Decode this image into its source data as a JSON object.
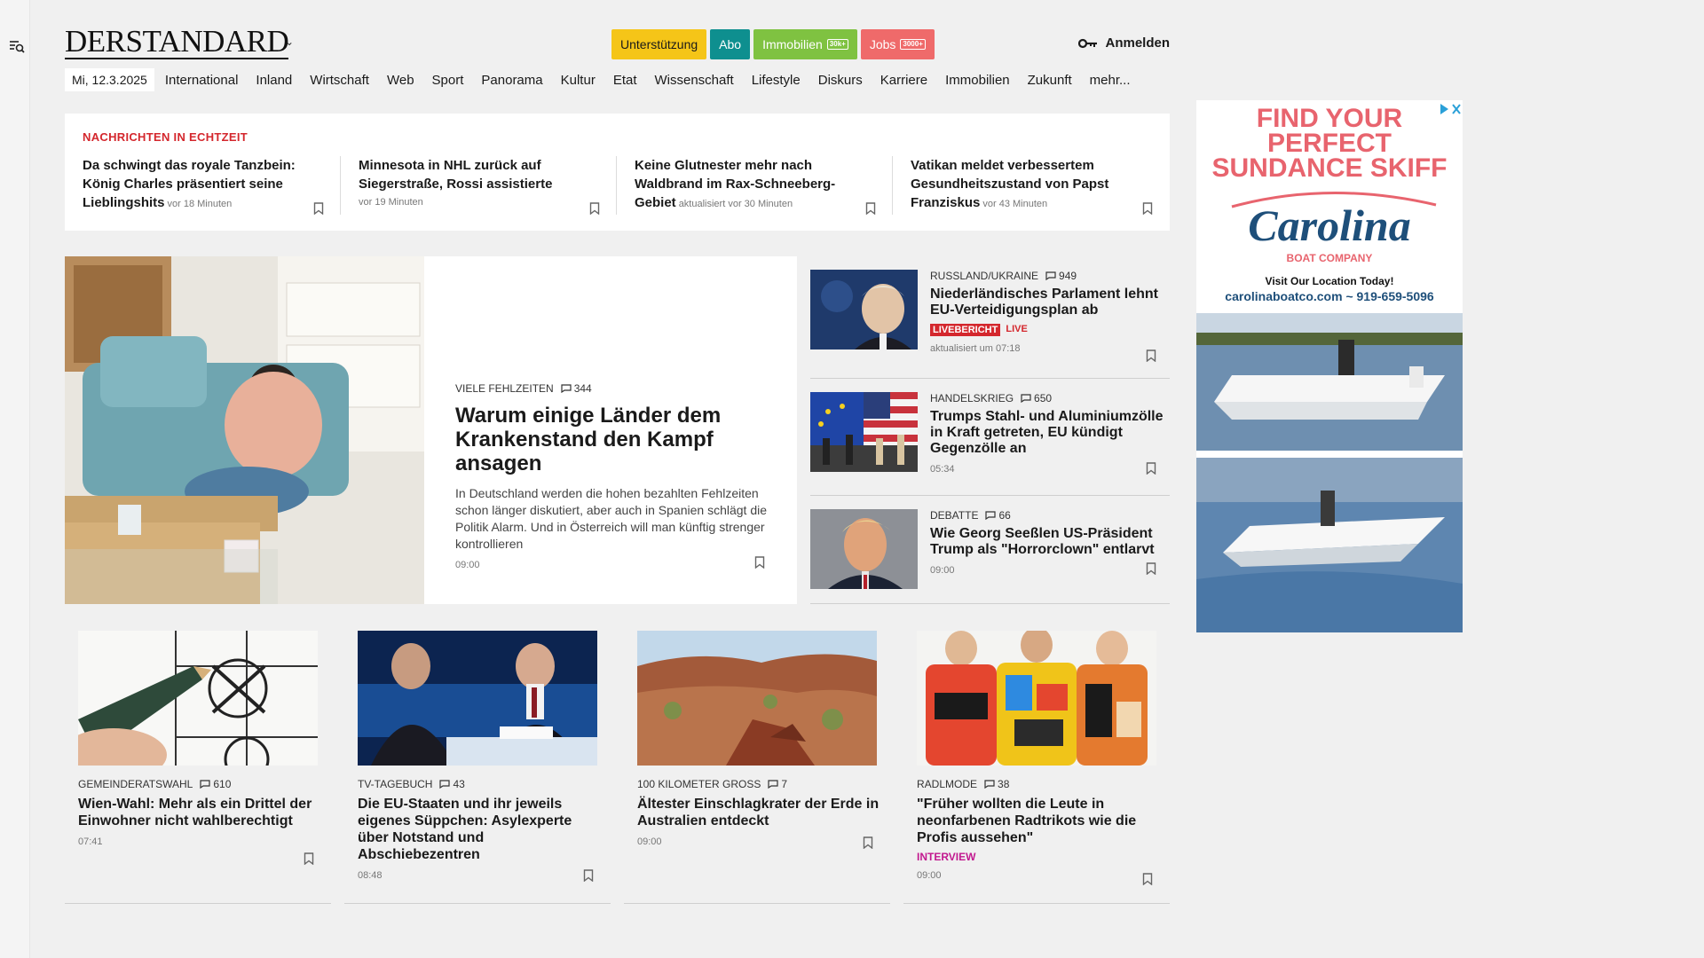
{
  "header": {
    "logo": "DERSTANDARD",
    "pills": [
      {
        "label": "Unterstützung",
        "bg": "#f5c518",
        "color": "#1a1a1a",
        "badge": ""
      },
      {
        "label": "Abo",
        "bg": "#0e8f8f",
        "color": "#ffffff",
        "badge": ""
      },
      {
        "label": "Immobilien",
        "bg": "#7fc241",
        "color": "#ffffff",
        "badge": "30k+"
      },
      {
        "label": "Jobs",
        "bg": "#ef6a6a",
        "color": "#ffffff",
        "badge": "3000+"
      }
    ],
    "login": "Anmelden"
  },
  "nav": {
    "date": "Mi, 12.3.2025",
    "items": [
      "International",
      "Inland",
      "Wirtschaft",
      "Web",
      "Sport",
      "Panorama",
      "Kultur",
      "Etat",
      "Wissenschaft",
      "Lifestyle",
      "Diskurs",
      "Karriere",
      "Immobilien",
      "Zukunft",
      "mehr..."
    ]
  },
  "ticker": {
    "title": "Nachrichten in Echtzeit",
    "items": [
      {
        "headline": "Da schwingt das royale Tanzbein: König Charles präsentiert seine Lieblingshits",
        "time": "vor 18 Minuten"
      },
      {
        "headline": "Minnesota in NHL zurück auf Siegerstraße, Rossi assistierte",
        "time": "vor 19 Minuten"
      },
      {
        "headline": "Keine Glutnester mehr nach Waldbrand im Rax-Schneeberg-Gebiet",
        "time": "aktualisiert vor 30 Minuten"
      },
      {
        "headline": "Vatikan meldet verbessertem Gesundheitszustand von Papst Franziskus",
        "time": "vor 43 Minuten"
      }
    ]
  },
  "hero": {
    "kicker": "Viele Fehlzeiten",
    "comments": "344",
    "title": "Warum einige Länder dem Krankenstand den Kampf ansagen",
    "lead": "In Deutschland werden die hohen bezahlten Fehlzeiten schon länger diskutiert, aber auch in Spanien schlägt die Politik Alarm. Und in Österreich will man künftig strenger kontrollieren",
    "time": "09:00"
  },
  "side": [
    {
      "kicker": "Russland/Ukraine",
      "comments": "949",
      "title": "Niederländisches Parlament lehnt EU-Verteidigungsplan ab",
      "badge": "LIVEBERICHT",
      "live": "LIVE",
      "time": "aktualisiert um 07:18"
    },
    {
      "kicker": "Handelskrieg",
      "comments": "650",
      "title": "Trumps Stahl- und Aluminiumzölle in Kraft getreten, EU kündigt Gegenzölle an",
      "time": "05:34"
    },
    {
      "kicker": "Debatte",
      "comments": "66",
      "title": "Wie Georg Seeßlen US-Präsident Trump als \"Horrorclown\" entlarvt",
      "time": "09:00"
    }
  ],
  "grid": [
    {
      "kicker": "Gemeinderatswahl",
      "comments": "610",
      "title": "Wien-Wahl: Mehr als ein Drittel der Einwohner nicht wahlberechtigt",
      "time": "07:41"
    },
    {
      "kicker": "TV-Tagebuch",
      "comments": "43",
      "title": "Die EU-Staaten und ihr jeweils eigenes Süppchen: Asylexperte über Notstand und Abschiebezentren",
      "time": "08:48"
    },
    {
      "kicker": "100 Kilometer groß",
      "comments": "7",
      "title": "Ältester Einschlagkrater der Erde in Australien entdeckt",
      "time": "09:00"
    },
    {
      "kicker": "Radlmode",
      "comments": "38",
      "title": "\"Früher wollten die Leute in neonfarbenen Radtrikots wie die Profis aussehen\"",
      "tag": "INTERVIEW",
      "time": "09:00"
    }
  ],
  "ad": {
    "headline_1": "FIND YOUR",
    "headline_2": "PERFECT",
    "headline_3": "SUNDANCE SKIFF",
    "brand": "Carolina",
    "brand_sub": "BOAT COMPANY",
    "cta": "Visit Our Location Today!",
    "contact": "carolinaboatco.com ~ 919-659-5096"
  },
  "colors": {
    "accent_red": "#d4272d",
    "interview_pink": "#c2188f",
    "page_bg": "#f0f0f0"
  }
}
